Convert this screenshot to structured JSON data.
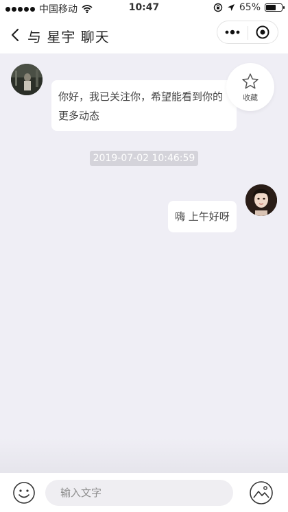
{
  "status_bar": {
    "carrier": "中国移动",
    "time": "10:47",
    "battery": "65%",
    "icons": [
      "signal-dots-icon",
      "wifi-icon",
      "orientation-lock-icon",
      "location-arrow-icon",
      "battery-icon"
    ]
  },
  "nav": {
    "title": "与 星宇 聊天",
    "back_icon": "chevron-left-icon",
    "menu_icon": "more-dots-icon",
    "close_icon": "target-circle-icon"
  },
  "favorite": {
    "label": "收藏",
    "icon": "star-icon"
  },
  "messages": [
    {
      "side": "left",
      "text": "你好，我已关注你，希望能看到你的更多动态",
      "avatar": "avatar-xingyu"
    },
    {
      "side": "right",
      "text": "嗨 上午好呀",
      "avatar": "avatar-me"
    }
  ],
  "timestamp": "2019-07-02 10:46:59",
  "input": {
    "placeholder": "输入文字",
    "value": ""
  },
  "bottom_icons": {
    "emoji": "smiley-icon",
    "image": "image-picture-icon"
  },
  "colors": {
    "background": "#efeef5",
    "bubble": "#ffffff",
    "timestamp_bg": "#d4d3da",
    "text": "#444444"
  }
}
